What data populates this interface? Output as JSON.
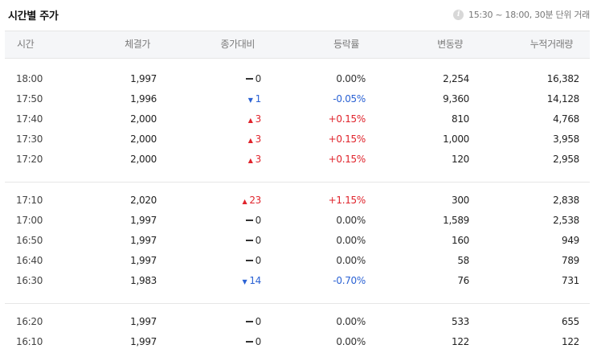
{
  "title": "시간별 주가",
  "info_text": "15:30 ~ 18:00, 30분 단위 거래",
  "headers": [
    "시간",
    "체결가",
    "종가대비",
    "등락률",
    "변동량",
    "누적거래량"
  ],
  "groups": [
    [
      {
        "time": "18:00",
        "price": "1,997",
        "dir": "flat",
        "change": "0",
        "rate": "0.00%",
        "vol": "2,254",
        "cum": "16,382"
      },
      {
        "time": "17:50",
        "price": "1,996",
        "dir": "down",
        "change": "1",
        "rate": "-0.05%",
        "vol": "9,360",
        "cum": "14,128"
      },
      {
        "time": "17:40",
        "price": "2,000",
        "dir": "up",
        "change": "3",
        "rate": "+0.15%",
        "vol": "810",
        "cum": "4,768"
      },
      {
        "time": "17:30",
        "price": "2,000",
        "dir": "up",
        "change": "3",
        "rate": "+0.15%",
        "vol": "1,000",
        "cum": "3,958"
      },
      {
        "time": "17:20",
        "price": "2,000",
        "dir": "up",
        "change": "3",
        "rate": "+0.15%",
        "vol": "120",
        "cum": "2,958"
      }
    ],
    [
      {
        "time": "17:10",
        "price": "2,020",
        "dir": "up",
        "change": "23",
        "rate": "+1.15%",
        "vol": "300",
        "cum": "2,838"
      },
      {
        "time": "17:00",
        "price": "1,997",
        "dir": "flat",
        "change": "0",
        "rate": "0.00%",
        "vol": "1,589",
        "cum": "2,538"
      },
      {
        "time": "16:50",
        "price": "1,997",
        "dir": "flat",
        "change": "0",
        "rate": "0.00%",
        "vol": "160",
        "cum": "949"
      },
      {
        "time": "16:40",
        "price": "1,997",
        "dir": "flat",
        "change": "0",
        "rate": "0.00%",
        "vol": "58",
        "cum": "789"
      },
      {
        "time": "16:30",
        "price": "1,983",
        "dir": "down",
        "change": "14",
        "rate": "-0.70%",
        "vol": "76",
        "cum": "731"
      }
    ],
    [
      {
        "time": "16:20",
        "price": "1,997",
        "dir": "flat",
        "change": "0",
        "rate": "0.00%",
        "vol": "533",
        "cum": "655"
      },
      {
        "time": "16:10",
        "price": "1,997",
        "dir": "flat",
        "change": "0",
        "rate": "0.00%",
        "vol": "122",
        "cum": "122"
      }
    ]
  ],
  "colors": {
    "up": "#e0242c",
    "down": "#2b62d4",
    "flat": "#333333"
  },
  "icons": {
    "info": "info-icon",
    "up": "triangle-up-icon",
    "down": "triangle-down-icon",
    "flat": "dash-icon"
  }
}
